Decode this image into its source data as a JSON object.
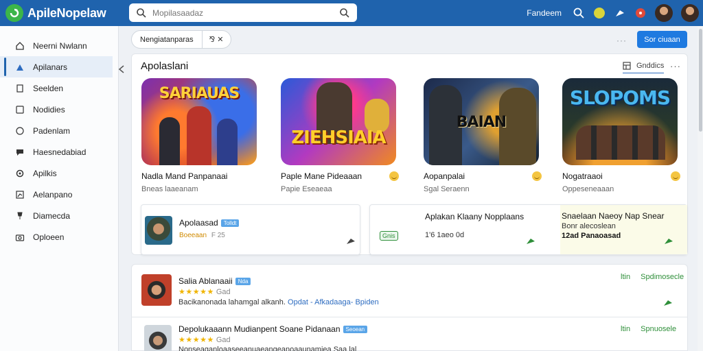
{
  "app": {
    "name": "ApileNopelaw"
  },
  "search": {
    "placeholder": "Mopilasaadaz"
  },
  "topbar": {
    "link_label": "Fandeem"
  },
  "sidebar": {
    "items": [
      {
        "label": "Neerni Nwlann",
        "icon": "home-icon"
      },
      {
        "label": "Apilanars",
        "icon": "apps-icon"
      },
      {
        "label": "Seelden",
        "icon": "document-icon"
      },
      {
        "label": "Nodidies",
        "icon": "file-icon"
      },
      {
        "label": "Padenlam",
        "icon": "globe-icon"
      },
      {
        "label": "Haesnedabiad",
        "icon": "chat-icon"
      },
      {
        "label": "Apilkis",
        "icon": "settings-icon"
      },
      {
        "label": "Aelanpano",
        "icon": "chart-icon"
      },
      {
        "label": "Diamecda",
        "icon": "pin-icon"
      },
      {
        "label": "Oploeen",
        "icon": "camera-icon"
      }
    ]
  },
  "filter": {
    "chip_label": "Nengiatanparas",
    "chip_close": "⅋ ✕"
  },
  "header": {
    "more": "···",
    "primary_button": "Sor ciuaan"
  },
  "section": {
    "title": "Apolaslani",
    "view_label": "Gnddics",
    "more": "···"
  },
  "featured": [
    {
      "banner": "SARIAUAS",
      "name": "Nadla Mand Panpanaai",
      "sub": "Bneas laaeanam",
      "smile": false
    },
    {
      "banner": "ZIEHSIAIA",
      "name": "Paple Mane Pideaaan",
      "sub": "Papie Eseaeaa",
      "smile": true
    },
    {
      "banner": "BAIAN",
      "name": "Aopanpalai",
      "sub": "Sgal Seraenn",
      "smile": true
    },
    {
      "banner": "SLOPOMS",
      "name": "Nogatraaoi",
      "sub": "Oppeseneaaan",
      "smile": true
    }
  ],
  "mini_cards": {
    "first": {
      "title": "Apolaasad",
      "tag": "Tolldt",
      "sub": "Boeeaan",
      "sub_tail": "F 25"
    },
    "second": {
      "badge": "Gnis",
      "title": "Aplakan Klaany Nopplaans",
      "sub": "1'6 1aeo 0d"
    },
    "third": {
      "title": "Snaelaan Naeoy Nap Snear",
      "sub1": "Bonr alecoslean",
      "sub2": "12ad Panaoasad"
    }
  },
  "list": [
    {
      "title": "Salia Ablanaaii",
      "tag": "Nda",
      "rating_count": "Gad",
      "meta_plain": "Bacikanonada lahamgal alkanh.",
      "meta_links": "Opdat - Afkadaaga- Bpiden",
      "right_label": "ltin",
      "right_link": "Spdimosecle"
    },
    {
      "title": "Depolukaaann Mudianpent Soane Pidanaan",
      "tag": "Seoean",
      "rating_count": "Gad",
      "meta_plain": "Nonseaganloaaseeanuaeangeanoaaunamiea Saa lal",
      "meta_links": "",
      "right_label": "ltin",
      "right_link": "Spnuosele"
    }
  ]
}
